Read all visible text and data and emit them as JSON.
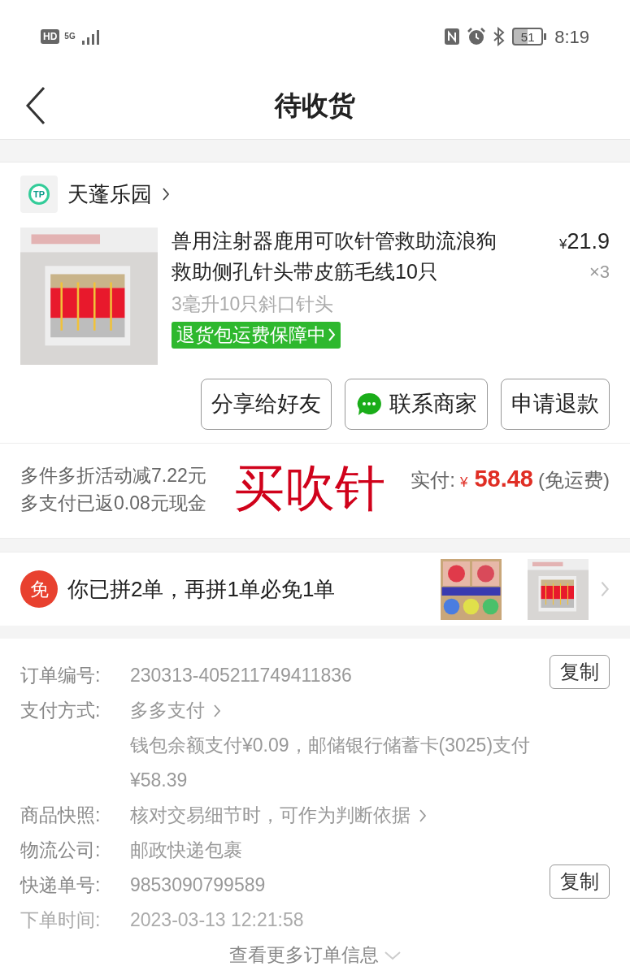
{
  "status_bar": {
    "hd": "HD",
    "network": "5G",
    "battery": "51",
    "time": "8:19"
  },
  "header": {
    "title": "待收货"
  },
  "shop": {
    "logo_text": "TP",
    "name": "天蓬乐园"
  },
  "product": {
    "kind": "picture",
    "title": "兽用注射器鹿用可吹针管救助流浪狗救助侧孔针头带皮筋毛线10只",
    "currency": "¥",
    "price": "21.9",
    "quantity": "×3",
    "spec": "3毫升10只斜口针头",
    "badge": "退货包运费保障中"
  },
  "actions": [
    {
      "kind": "plain",
      "label": "分享给好友"
    },
    {
      "kind": "chat",
      "label": "联系商家"
    },
    {
      "kind": "plain",
      "label": "申请退款"
    }
  ],
  "summary": {
    "lines": [
      "多件多折活动减7.22元",
      "多支付已返0.08元现金"
    ],
    "paid_label": "实付:",
    "currency": "¥",
    "paid": "58.48",
    "shipping": "(免运费)"
  },
  "annotation": "买吹针",
  "promo": {
    "badge": "免",
    "text": "你已拼2单，再拼1单必免1单"
  },
  "order_info": {
    "rows": [
      {
        "label": "订单编号:",
        "value": "230313-405211749411836",
        "copy": "复制",
        "link": false
      },
      {
        "label": "支付方式:",
        "value": "多多支付",
        "link": true,
        "detail": [
          "钱包余额支付¥0.09，邮储银行储蓄卡(3025)支付",
          "¥58.39"
        ]
      },
      {
        "label": "商品快照:",
        "value": "核对交易细节时，可作为判断依据",
        "link": true
      },
      {
        "label": "物流公司:",
        "value": "邮政快递包裹",
        "link": false
      },
      {
        "label": "快递单号:",
        "value": "9853090799589",
        "copy": "复制",
        "link": false
      },
      {
        "label": "下单时间:",
        "value": "2023-03-13 12:21:58",
        "link": false
      }
    ],
    "more": "查看更多订单信息"
  }
}
